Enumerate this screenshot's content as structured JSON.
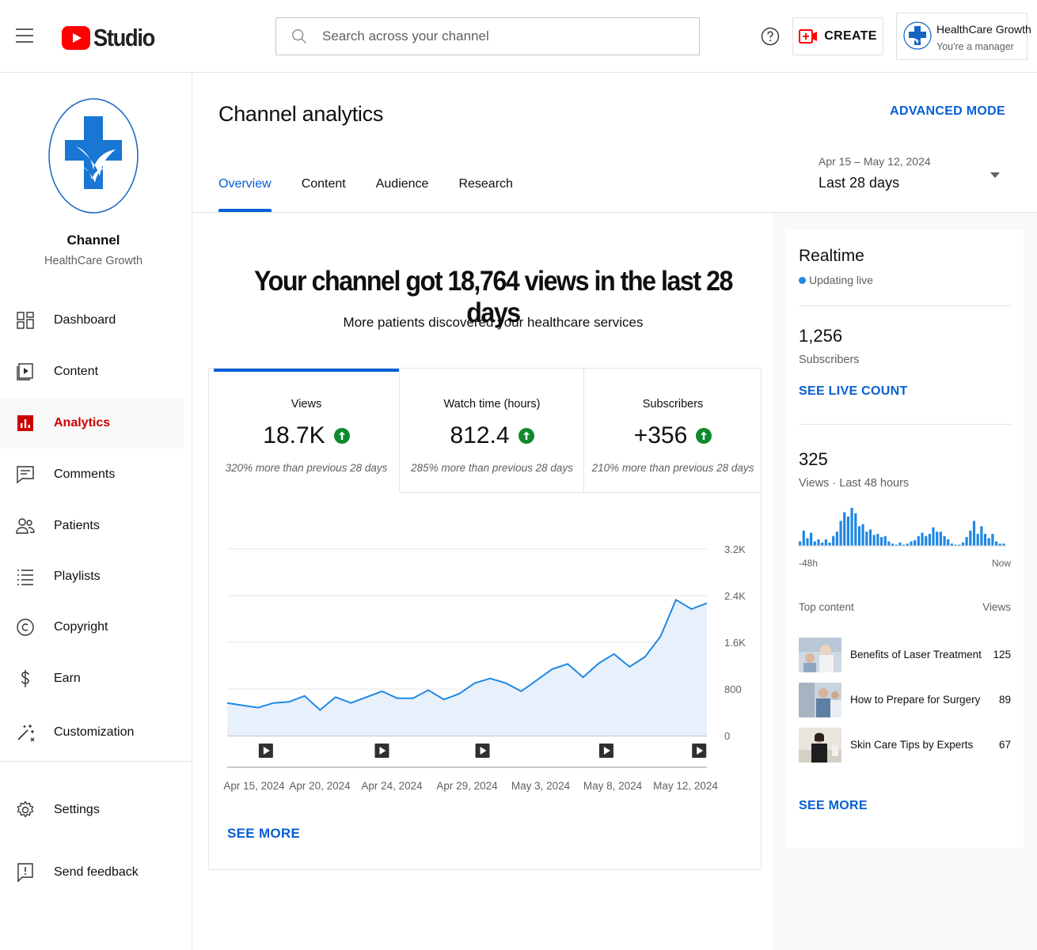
{
  "topbar": {
    "logo_text": "Studio",
    "search_placeholder": "Search across your channel",
    "create_label": "CREATE",
    "account_name": "HealthCare Growth",
    "account_role": "You're a manager"
  },
  "sidebar": {
    "channel_title": "Channel",
    "channel_name": "HealthCare Growth",
    "items": [
      {
        "label": "Dashboard",
        "icon": "dashboard-icon"
      },
      {
        "label": "Content",
        "icon": "content-icon"
      },
      {
        "label": "Analytics",
        "icon": "analytics-icon",
        "active": true
      },
      {
        "label": "Comments",
        "icon": "comments-icon"
      },
      {
        "label": "Patients",
        "icon": "patients-icon"
      },
      {
        "label": "Playlists",
        "icon": "playlists-icon"
      },
      {
        "label": "Copyright",
        "icon": "copyright-icon"
      },
      {
        "label": "Earn",
        "icon": "earn-icon"
      },
      {
        "label": "Customization",
        "icon": "customization-icon"
      },
      {
        "label": "Settings",
        "icon": "gear-icon"
      },
      {
        "label": "Send feedback",
        "icon": "feedback-icon"
      }
    ]
  },
  "header": {
    "title": "Channel analytics",
    "advanced_mode": "ADVANCED MODE",
    "tabs": [
      {
        "label": "Overview",
        "active": true
      },
      {
        "label": "Content"
      },
      {
        "label": "Audience"
      },
      {
        "label": "Research"
      }
    ],
    "date_span": "Apr 15 – May 12, 2024",
    "date_label": "Last 28 days"
  },
  "overview": {
    "headline": "Your channel got 18,764 views in the last 28 days",
    "subline": "More patients discovered your healthcare services",
    "metrics": [
      {
        "label": "Views",
        "value": "18.7K",
        "note": "320% more than previous 28 days"
      },
      {
        "label": "Watch time (hours)",
        "value": "812.4",
        "note": "285% more than previous 28 days"
      },
      {
        "label": "Subscribers",
        "value": "+356",
        "note": "210% more than previous 28 days"
      }
    ],
    "see_more": "SEE MORE"
  },
  "chart_data": {
    "type": "area",
    "series": [
      {
        "values": [
          560,
          520,
          480,
          560,
          580,
          680,
          440,
          660,
          560,
          660,
          760,
          640,
          640,
          780,
          620,
          720,
          900,
          980,
          900,
          760,
          950,
          1140,
          1230,
          1000,
          1240,
          1400,
          1180,
          1350,
          1700,
          2330,
          2170,
          2270
        ]
      }
    ],
    "x_tick_labels": [
      "Apr 15, 2024",
      "Apr 20, 2024",
      "Apr 24, 2024",
      "Apr 29, 2024",
      "May 3, 2024",
      "May 8, 2024",
      "May 12, 2024"
    ],
    "y_tick_labels": [
      "0",
      "800",
      "1.6K",
      "2.4K",
      "3.2K"
    ],
    "ylim": [
      0,
      3200
    ],
    "grid": true,
    "color": "#1e88e5",
    "fill_color": "#e8f0fb"
  },
  "realtime": {
    "title": "Realtime",
    "status": "Updating live",
    "subscribers_value": "1,256",
    "subscribers_label": "Subscribers",
    "see_live_count": "SEE LIVE COUNT",
    "views_value": "325",
    "views_label": "Views · Last 48 hours",
    "spark_values": [
      4,
      14,
      7,
      12,
      4,
      6,
      3,
      6,
      3,
      9,
      13,
      23,
      31,
      27,
      35,
      30,
      18,
      20,
      13,
      15,
      10,
      11,
      8,
      9,
      4,
      2,
      1,
      3,
      1,
      2,
      4,
      5,
      9,
      12,
      9,
      11,
      17,
      13,
      13,
      9,
      6,
      2,
      1,
      1,
      3,
      8,
      14,
      23,
      11,
      18,
      11,
      7,
      11,
      4,
      2,
      2
    ],
    "spark_left": "-48h",
    "spark_right": "Now",
    "top_content_label": "Top content",
    "top_content_views_label": "Views",
    "top_content": [
      {
        "title": "Benefits of Laser Treatment",
        "views": "125"
      },
      {
        "title": "How to Prepare for Surgery",
        "views": "89"
      },
      {
        "title": "Skin Care Tips by Experts",
        "views": "67"
      }
    ],
    "see_more": "SEE MORE"
  },
  "colors": {
    "accent_blue": "#065fd4",
    "analytics_red": "#cc0000",
    "brand_red": "#ff0000",
    "up_green": "#0f8a2e"
  }
}
